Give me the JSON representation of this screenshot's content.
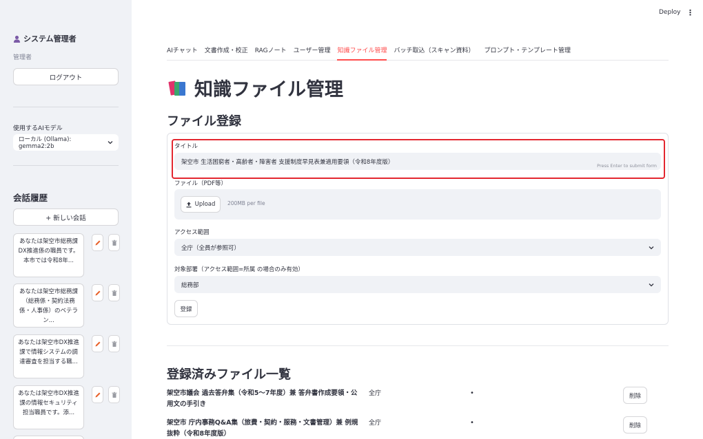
{
  "sidebar": {
    "user_name": "システム管理者",
    "user_role": "管理者",
    "logout_label": "ログアウト",
    "model_label": "使用するAIモデル",
    "model_value": "ローカル (Ollama): gemma2:2b",
    "history_title": "会話履歴",
    "new_chat_label": "+ 新しい会話",
    "history": [
      {
        "text": "あなたは架空市総務課DX推進係の職員です。本市では令和8年..."
      },
      {
        "text": "あなたは架空市総務課（総務係・契約法務係・人事係）のベテラン..."
      },
      {
        "text": "あなたは架空市DX推進課で情報システムの調達審査を担当する職..."
      },
      {
        "text": "あなたは架空市DX推進課の情報セキュリティ担当職員です。添..."
      }
    ]
  },
  "header": {
    "deploy_label": "Deploy",
    "menu_icon": "⋮"
  },
  "tabs": [
    {
      "label": "AIチャット",
      "active": false
    },
    {
      "label": "文書作成・校正",
      "active": false
    },
    {
      "label": "RAGノート",
      "active": false
    },
    {
      "label": "ユーザー管理",
      "active": false
    },
    {
      "label": "知識ファイル管理",
      "active": true
    },
    {
      "label": "バッチ取込（スキャン資料）",
      "active": false
    },
    {
      "label": "プロンプト・テンプレート管理",
      "active": false
    }
  ],
  "page": {
    "title": "知識ファイル管理",
    "register_heading": "ファイル登録",
    "list_heading": "登録済みファイル一覧"
  },
  "form": {
    "title_label": "タイトル",
    "title_value": "架空市 生活困窮者・高齢者・障害者 支援制度早見表兼適用要領（令和8年度版）",
    "title_hint": "Press Enter to submit form",
    "file_label": "ファイル（PDF等）",
    "upload_label": "Upload",
    "upload_limit": "200MB per file",
    "access_label": "アクセス範囲",
    "access_value": "全庁（全員が参照可）",
    "dept_label": "対象部署（アクセス範囲=所属 の場合のみ有効）",
    "dept_value": "総務部",
    "submit_label": "登録"
  },
  "files": [
    {
      "name": "架空市議会 過去答弁集（令和5〜7年度）兼 答弁書作成要領・公用文の手引き",
      "scope": "全庁",
      "dot": "•",
      "delete_label": "削除"
    },
    {
      "name": "架空市 庁内事務Q&A集（旅費・契約・服務・文書管理）兼 例規抜粋（令和8年度版）",
      "scope": "全庁",
      "dot": "•",
      "delete_label": "削除"
    }
  ],
  "colors": {
    "accent": "#ff4b4b",
    "highlight": "#e3262f",
    "sidebar_bg": "#f0f2f6",
    "edit_icon": "#e8622c"
  }
}
